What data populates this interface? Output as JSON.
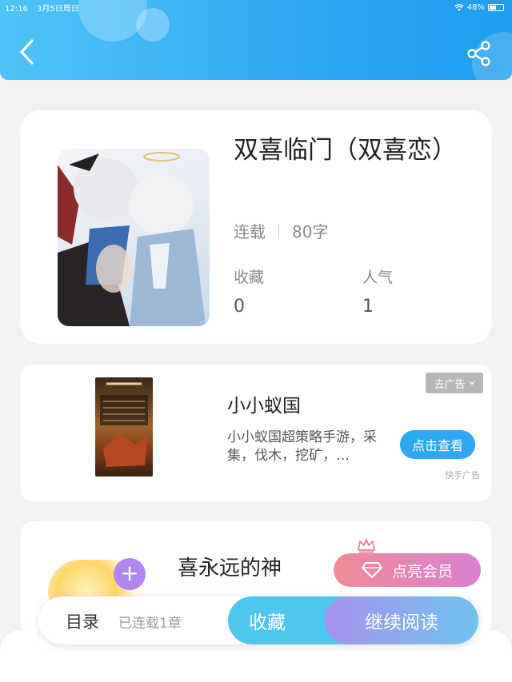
{
  "status_bar": {
    "time": "12:16",
    "date": "3月5日周日",
    "battery": "48%"
  },
  "colors": {
    "accent": "#2fa8f3",
    "vip": "#ef8c96",
    "read_button": "#a693ee"
  },
  "header": {
    "back_icon": "chevron-left-icon",
    "share_icon": "share-icon"
  },
  "book": {
    "title": "双喜临门（双喜恋）",
    "status": "连载",
    "word_count": "80字",
    "stats": [
      {
        "label": "收藏",
        "value": "0"
      },
      {
        "label": "人气",
        "value": "1"
      }
    ]
  },
  "ad": {
    "title": "小小蚁国",
    "description": "小小蚁国超策略手游，采集，伐木，挖矿，…",
    "close_label": "去广告",
    "button_label": "点击查看",
    "source": "快手广告"
  },
  "author": {
    "name": "喜永远的神",
    "follow_label": "+",
    "vip_label": "点亮会员"
  },
  "bottom_bar": {
    "catalog_label": "目录",
    "chapters_label": "已连载1章",
    "collect_label": "收藏",
    "read_label": "继续阅读"
  }
}
